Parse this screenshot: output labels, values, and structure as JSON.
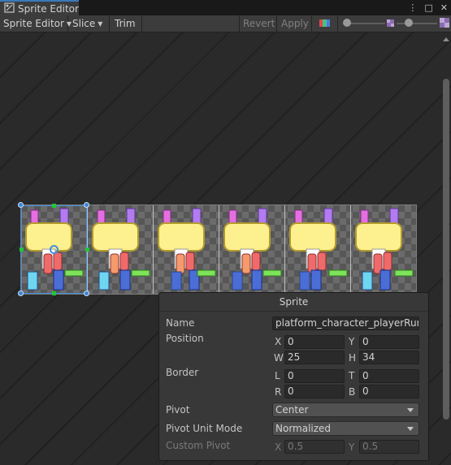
{
  "window": {
    "tab_title": "Sprite Editor",
    "controls": [
      "⋮",
      "□",
      "✕"
    ]
  },
  "toolbar": {
    "mode_label": "Sprite Editor",
    "slice_label": "Slice",
    "trim_label": "Trim",
    "revert_label": "Revert",
    "apply_label": "Apply",
    "zoom_level": 0.05,
    "mip_level": 0.3
  },
  "sprite_sheet": {
    "frames": 6,
    "selected_index": 0
  },
  "inspector": {
    "title": "Sprite",
    "name_label": "Name",
    "name_value": "platform_character_playerRun_",
    "position_label": "Position",
    "x_label": "X",
    "x_value": "0",
    "y_label": "Y",
    "y_value": "0",
    "w_label": "W",
    "w_value": "25",
    "h_label": "H",
    "h_value": "34",
    "border_label": "Border",
    "l_label": "L",
    "l_value": "0",
    "t_label": "T",
    "t_value": "0",
    "r_label": "R",
    "r_value": "0",
    "b_label": "B",
    "b_value": "0",
    "pivot_label": "Pivot",
    "pivot_value": "Center",
    "pivot_unit_label": "Pivot Unit Mode",
    "pivot_unit_value": "Normalized",
    "custom_pivot_label": "Custom Pivot",
    "cpx_label": "X",
    "cpx_value": "0.5",
    "cpy_label": "Y",
    "cpy_value": "0.5"
  },
  "colors": {
    "selection": "#3d8fe0",
    "handle_green": "#1ec73a",
    "body_yellow": "#fdf08e",
    "ear_purple": "#b37bf0",
    "ear_pink": "#e56fe0",
    "leg_green": "#7ee35a",
    "leg_blue": "#4b6dd6",
    "leg_cyan": "#6ed6f0",
    "arm_red": "#ef6a6a",
    "arm_orange": "#f49a6c"
  }
}
